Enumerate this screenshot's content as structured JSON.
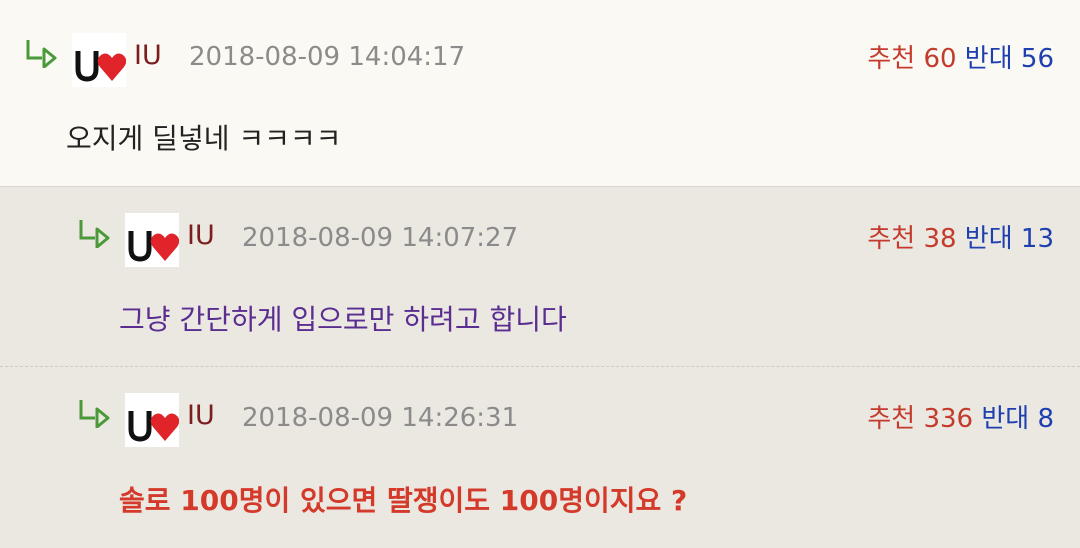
{
  "colors": {
    "nick": "#7a1e1e",
    "date": "#8b8b8b",
    "recommend": "#c43a2c",
    "oppose": "#1e3fb0",
    "text1": "#222222",
    "text2": "#5a2d91",
    "text3": "#d43a2a"
  },
  "comments": [
    {
      "nickname": "IU",
      "date": "2018-08-09 14:04:17",
      "recommend_label": "추천",
      "recommend": "60",
      "oppose_label": "반대",
      "oppose": "56",
      "text": "오지게 딜넣네 ㅋㅋㅋㅋ"
    },
    {
      "nickname": "IU",
      "date": "2018-08-09 14:07:27",
      "recommend_label": "추천",
      "recommend": "38",
      "oppose_label": "반대",
      "oppose": "13",
      "text": "그냥 간단하게 입으로만 하려고 합니다"
    },
    {
      "nickname": "IU",
      "date": "2018-08-09 14:26:31",
      "recommend_label": "추천",
      "recommend": "336",
      "oppose_label": "반대",
      "oppose": "8",
      "text": "솔로 100명이 있으면 딸쟁이도 100명이지요 ?"
    }
  ]
}
